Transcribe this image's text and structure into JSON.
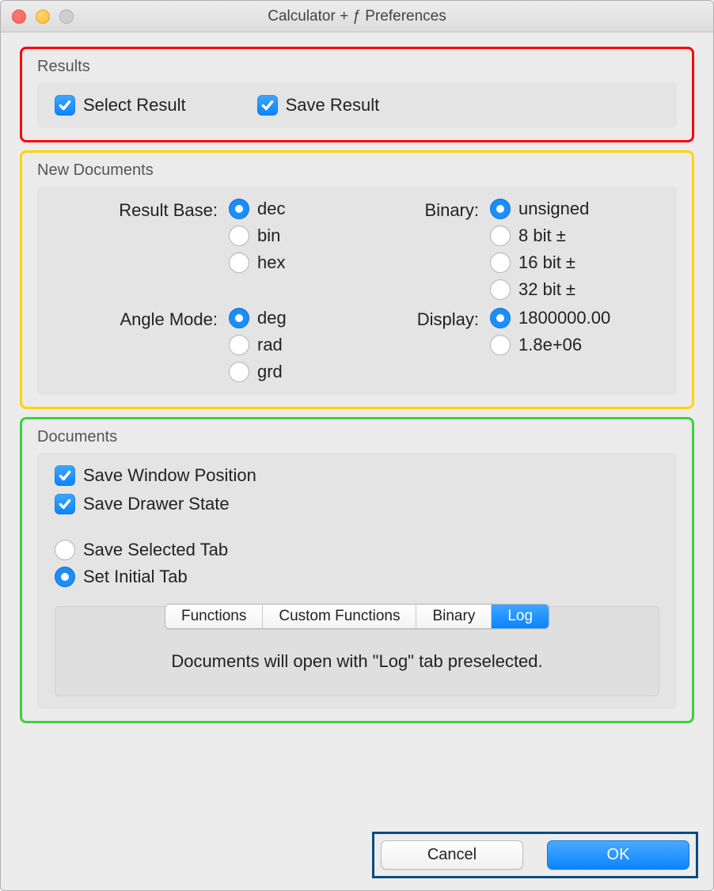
{
  "window": {
    "title": "Calculator + ƒ Preferences"
  },
  "results": {
    "title": "Results",
    "select_label": "Select Result",
    "save_label": "Save Result"
  },
  "newdocs": {
    "title": "New Documents",
    "result_base_label": "Result Base:",
    "result_base": {
      "options": [
        "dec",
        "bin",
        "hex"
      ],
      "selected": "dec"
    },
    "binary_label": "Binary:",
    "binary": {
      "options": [
        "unsigned",
        "8 bit ±",
        "16 bit ±",
        "32 bit ±"
      ],
      "selected": "unsigned"
    },
    "angle_label": "Angle Mode:",
    "angle": {
      "options": [
        "deg",
        "rad",
        "grd"
      ],
      "selected": "deg"
    },
    "display_label": "Display:",
    "display": {
      "options": [
        "1800000.00",
        "1.8e+06"
      ],
      "selected": "1800000.00"
    }
  },
  "documents": {
    "title": "Documents",
    "save_window_label": "Save Window Position",
    "save_drawer_label": "Save Drawer State",
    "tab_mode": {
      "options": [
        "Save Selected Tab",
        "Set Initial Tab"
      ],
      "selected": "Set Initial Tab"
    },
    "tabs": {
      "options": [
        "Functions",
        "Custom Functions",
        "Binary",
        "Log"
      ],
      "selected": "Log"
    },
    "message": "Documents will open with \"Log\" tab preselected."
  },
  "buttons": {
    "cancel": "Cancel",
    "ok": "OK"
  }
}
